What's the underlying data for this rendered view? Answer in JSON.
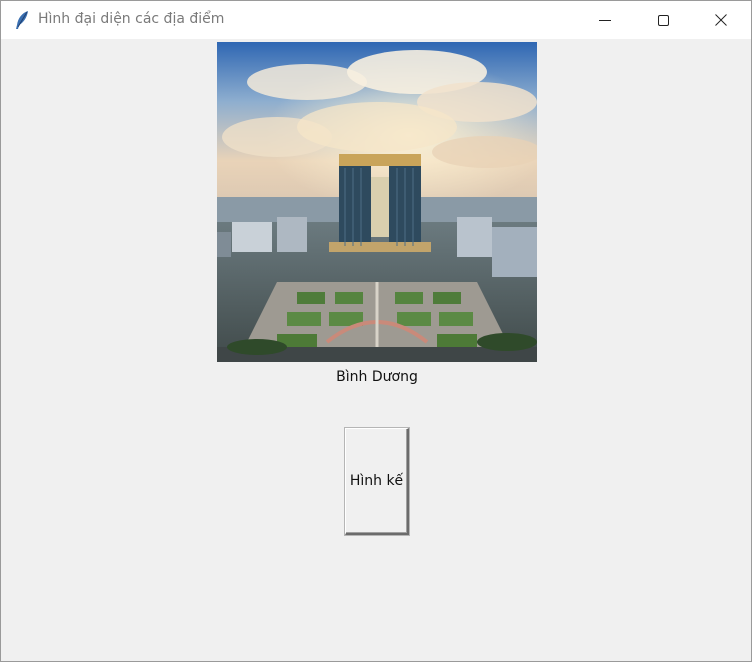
{
  "window": {
    "title": "Hình đại diện các địa điểm",
    "app_icon": "feather-icon",
    "controls": [
      "minimize-icon",
      "maximize-icon",
      "close-icon"
    ]
  },
  "main": {
    "image_caption": "Bình Dương",
    "next_button_label": "Hình kế"
  },
  "colors": {
    "window_background": "#f0f0f0",
    "titlebar_background": "#ffffff",
    "title_text": "#7a7a7a"
  }
}
